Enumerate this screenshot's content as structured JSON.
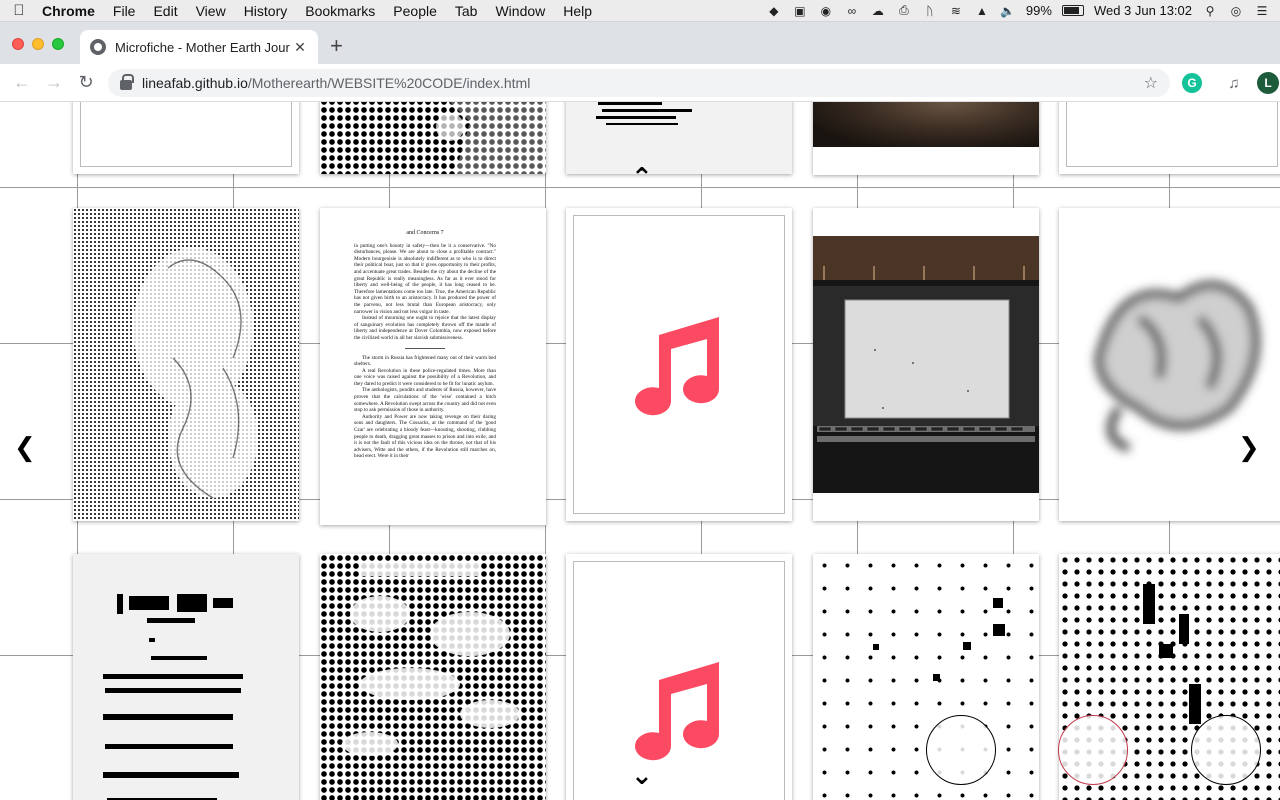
{
  "menubar": {
    "app_name": "Chrome",
    "items": [
      "File",
      "Edit",
      "View",
      "History",
      "Bookmarks",
      "People",
      "Tab",
      "Window",
      "Help"
    ],
    "battery_percent": "99%",
    "clock": "Wed 3 Jun  13:02",
    "status_icons": [
      "dropbox-icon",
      "display-icon",
      "evernote-icon",
      "creative-cloud-icon",
      "cloud-sync-icon",
      "printer-icon",
      "bluetooth-icon",
      "wifi-icon",
      "airplay-icon",
      "volume-icon",
      "battery-icon",
      "spotlight-search-icon",
      "siri-icon",
      "notification-center-icon"
    ]
  },
  "browser": {
    "tab_title": "Microfiche - Mother Earth Jour",
    "url_host": "lineafab.github.io",
    "url_path": "/Motherearth/WEBSITE%20CODE/index.html",
    "profile_initial": "L",
    "extension_initial": "G"
  },
  "gallery": {
    "doc_page": {
      "header": "and Concerns                7",
      "paragraphs": [
        "in putting one's bounty in safety—then be it a conservative. \"No disturbances, please. We are about to close a profitable contract.\" Modern bourgeoisie is absolutely indifferent as to who is to direct their political boat, just so that it gives opportunity to their profits, and accentuate great trades. Besides the cry about the decline of the great Republic is really meaningless. As far as it ever stood for liberty and well-being of the people, it has long ceased to be. Therefore lamentations come too late. True, the American Republic has not given birth to an aristocracy. It has produced the power of the parvenu, not less brutal than European aristocracy, only narrower in vision and not less vulgar in taste.",
        "Instead of mourning one ought to rejoice that the latest display of sanguinary evolution has completely thrown off the mantle of liberty and independence at Dover Colombia, now exposed before the civilized world in all her slavish submissiveness.",
        "The storm in Russia has frightened many out of their warm bed shelters.",
        "A real Revolution in these police-regulated times. More than one voice was raised against the possibility of a Revolution, and they dared to predict it were considered to be fit for lunatic asylum.",
        "The anthologists, pundits and students of Russia, however, have proven that the calculations of the 'wise' contained a hitch somewhere. A Revolution swept across the country and did not even stop to ask permission of those in authority.",
        "Authority and Power are now taking revenge on their daring sons and daughters. The Cossacks, at the command of the 'good Czar' are celebrating a bloody feast—knouting, shooting, clubbing people to death, dragging great masses to prison and into exile, and it is not the fault of this vicious idea on the throne, not that of his advisers, Witte and the others, if the Revolution still marches on, head erect. Were it in their"
      ]
    }
  },
  "colors": {
    "accent_music": "#fb4a62",
    "grid_line": "#9a9a9a",
    "circle_red": "#c0394b"
  }
}
